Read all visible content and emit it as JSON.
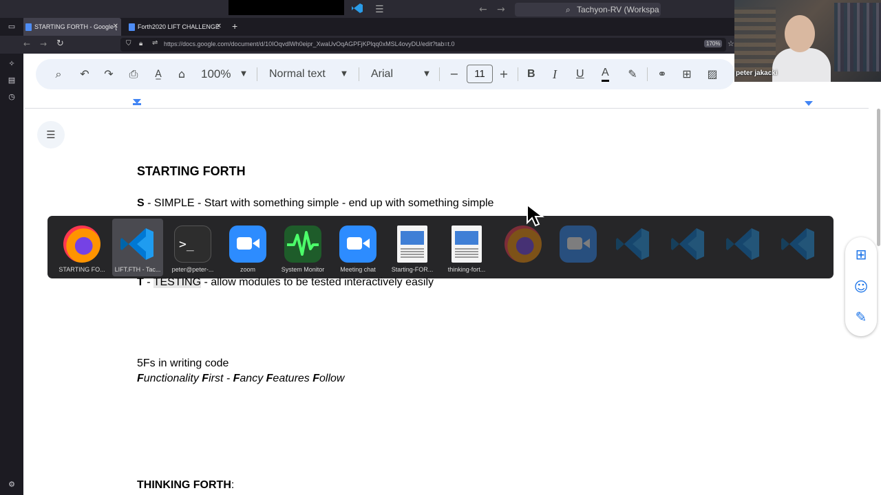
{
  "topbar": {
    "menu_glyph": "☰",
    "back_glyph": "←",
    "forward_glyph": "→",
    "search_text": "Tachyon-RV (Workspa"
  },
  "tabs": [
    {
      "label": "STARTING FORTH - Google [",
      "close": "✕"
    },
    {
      "label": "Forth2020 LIFT CHALLENGE",
      "close": "✕"
    }
  ],
  "new_tab": "+",
  "urlbar": {
    "url": "https://docs.google.com/document/d/10IOqvdlWh0eipr_XwaUvOqAGPFjKPlqq0xMSL4ovyDU/edit?tab=t.0",
    "zoom": "170%"
  },
  "toolbar": {
    "zoom": "100%",
    "style": "Normal text",
    "font": "Arial",
    "font_size": "11",
    "minus": "−",
    "plus": "+",
    "bold": "B",
    "italic": "I",
    "underline": "U",
    "text_color": "A"
  },
  "doc": {
    "title": "STARTING FORTH",
    "s_letter": "S",
    "s_rest": " - SIMPLE - Start with something simple - end up with something simple",
    "t_letter": "T",
    "t_sep": " - ",
    "t_word": "TESTING",
    "t_rest": " - allow modules to be tested interactively easily",
    "fivefs": "5Fs in writing code",
    "ff_f1": "F",
    "ff_w1": "unctionality ",
    "ff_f2": "F",
    "ff_w2": "irst - ",
    "ff_f3": "F",
    "ff_w3": "ancy ",
    "ff_f4": "F",
    "ff_w4": "eatures ",
    "ff_f5": "F",
    "ff_w5": "ollow",
    "thinking": "THINKING FORTH",
    "thinking_colon": ":"
  },
  "webcam": {
    "name": "peter jakacki"
  },
  "switcher": {
    "items": [
      {
        "label": "STARTING FO...",
        "icon": "firefox-icon"
      },
      {
        "label": "LIFT.FTH - Tac...",
        "icon": "vscode-icon"
      },
      {
        "label": "peter@peter-...",
        "icon": "terminal-icon"
      },
      {
        "label": "zoom",
        "icon": "zoom-icon"
      },
      {
        "label": "System Monitor",
        "icon": "system-monitor-icon"
      },
      {
        "label": "Meeting chat",
        "icon": "zoom-icon"
      },
      {
        "label": "Starting-FOR...",
        "icon": "document-icon"
      },
      {
        "label": "thinking-fort...",
        "icon": "document-icon"
      },
      {
        "label": "",
        "icon": "firefox-icon"
      },
      {
        "label": "",
        "icon": "zoom-icon"
      },
      {
        "label": "",
        "icon": "vscode-icon"
      },
      {
        "label": "",
        "icon": "vscode-icon"
      },
      {
        "label": "",
        "icon": "vscode-icon"
      },
      {
        "label": "",
        "icon": "vscode-icon"
      }
    ]
  },
  "colors": {
    "accent": "#1a73e8",
    "toolbar_bg": "#edf2fa",
    "switcher_bg": "#141416",
    "vscode_blue": "#0078d4"
  }
}
